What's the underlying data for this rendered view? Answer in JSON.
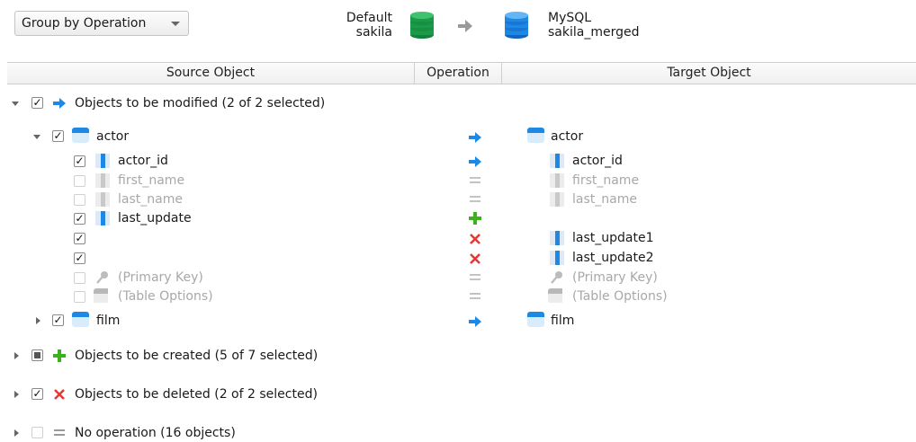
{
  "toolbar": {
    "group_by": "Group by Operation",
    "source": {
      "line1": "Default",
      "line2": "sakila"
    },
    "target": {
      "line1": "MySQL",
      "line2": "sakila_merged"
    }
  },
  "columns": {
    "source": "Source Object",
    "operation": "Operation",
    "target": "Target Object"
  },
  "groups": {
    "modified": "Objects to be modified (2 of 2 selected)",
    "created": "Objects to be created (5 of 7 selected)",
    "deleted": "Objects to be deleted (2 of 2 selected)",
    "noop": "No operation (16 objects)"
  },
  "actor": {
    "source": "actor",
    "target": "actor",
    "columns": [
      {
        "source": "actor_id",
        "target": "actor_id",
        "op": "modify",
        "checked": true
      },
      {
        "source": "first_name",
        "target": "first_name",
        "op": "none",
        "checked": false
      },
      {
        "source": "last_name",
        "target": "last_name",
        "op": "none",
        "checked": false
      },
      {
        "source": "last_update",
        "target": "",
        "op": "create",
        "checked": true
      },
      {
        "source": "",
        "target": "last_update1",
        "op": "delete",
        "checked": true
      },
      {
        "source": "",
        "target": "last_update2",
        "op": "delete",
        "checked": true
      },
      {
        "source": "(Primary Key)",
        "target": "(Primary Key)",
        "op": "none",
        "checked": false
      },
      {
        "source": "(Table Options)",
        "target": "(Table Options)",
        "op": "none",
        "checked": false
      }
    ]
  },
  "film": {
    "source": "film",
    "target": "film"
  },
  "colors": {
    "modify": "#1e88e5",
    "create": "#3cb01d",
    "delete": "#e53935",
    "none": "#bdbdbd",
    "source_db": "#1a9a4a",
    "target_db": "#1e88e5"
  }
}
